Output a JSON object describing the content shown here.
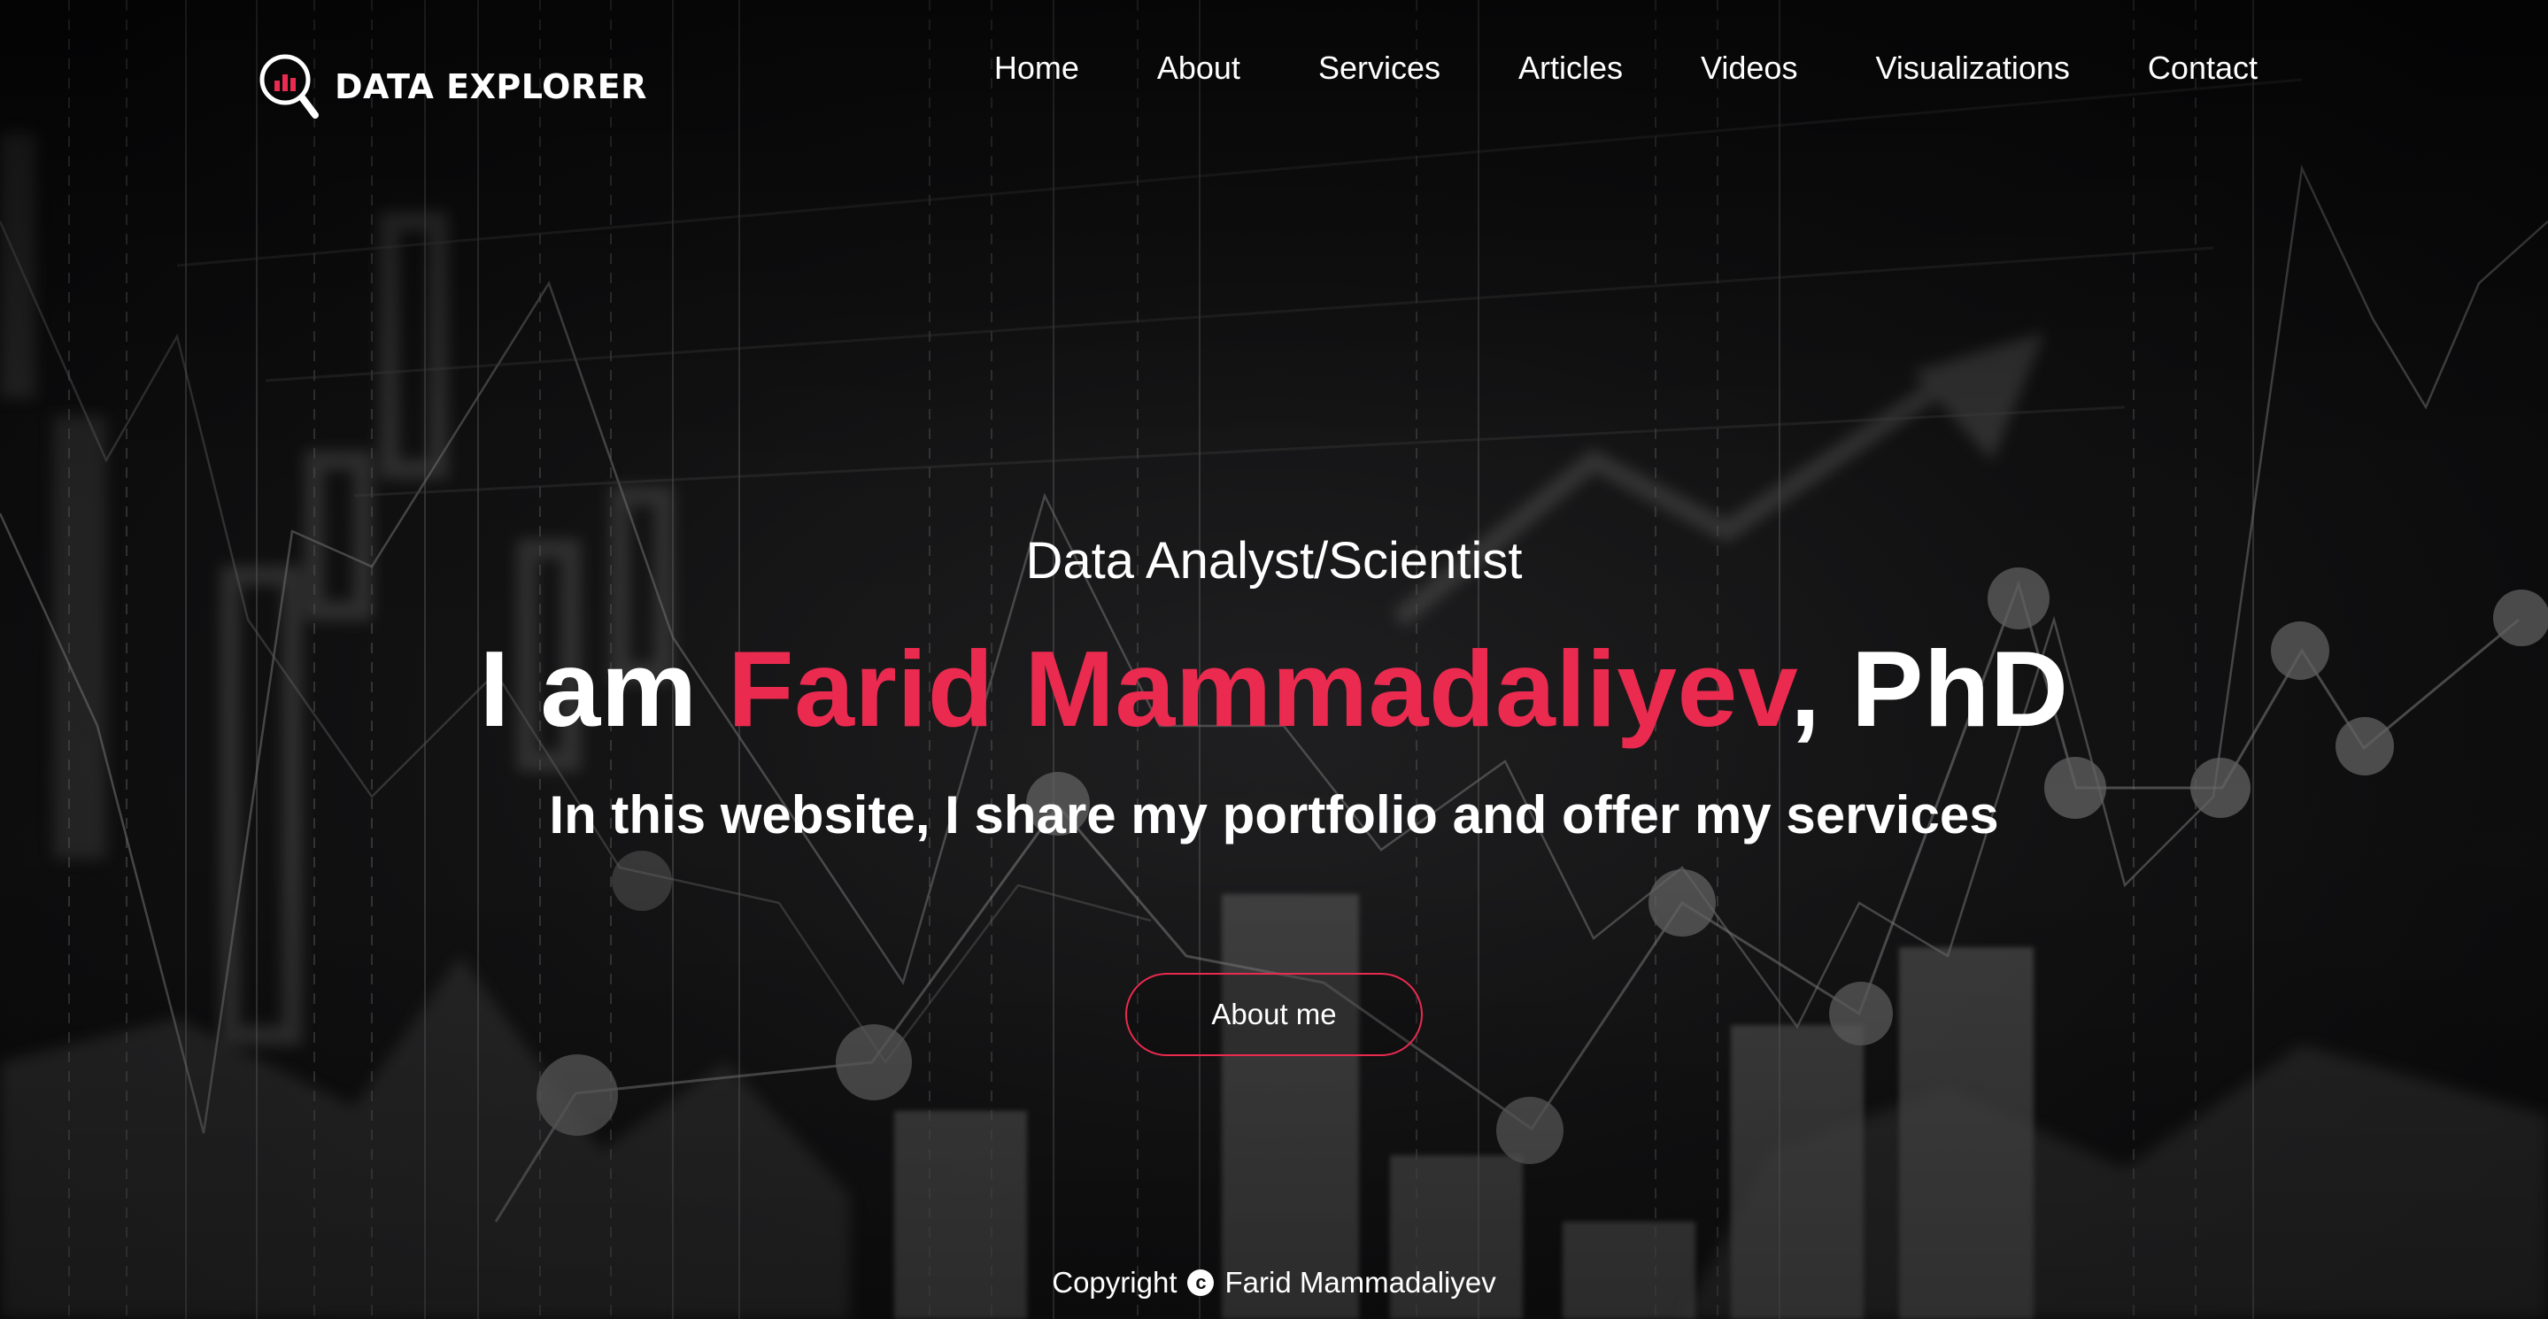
{
  "brand": {
    "logo_text": "DATA EXPLORER",
    "logo_icon": "magnifier-bar-chart-icon",
    "accent_color": "#ea2a4f"
  },
  "nav": {
    "items": [
      {
        "label": "Home"
      },
      {
        "label": "About"
      },
      {
        "label": "Services"
      },
      {
        "label": "Articles"
      },
      {
        "label": "Videos"
      },
      {
        "label": "Visualizations"
      },
      {
        "label": "Contact"
      }
    ]
  },
  "hero": {
    "subtitle": "Data Analyst/Scientist",
    "title_prefix": "I am ",
    "title_name": "Farid Mammadaliyev",
    "title_suffix": ", PhD",
    "description": "In this website, I share my portfolio and offer my services",
    "cta_label": "About me"
  },
  "footer": {
    "copyright_label": "Copyright",
    "copyright_icon": "copyright-icon",
    "copyright_symbol": "c",
    "owner": "Farid Mammadaliyev"
  },
  "colors": {
    "background": "#0b0b0c",
    "text": "#ffffff",
    "accent": "#ea2a4f"
  }
}
